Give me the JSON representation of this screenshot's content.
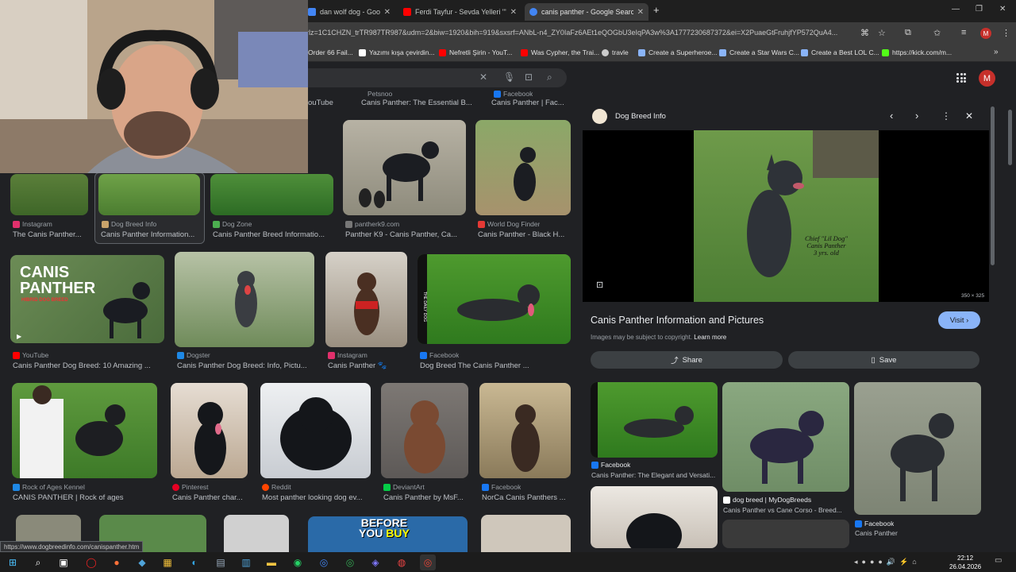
{
  "tabs": [
    {
      "title": "dan wolf dog - Google Se",
      "color": "#4285f4"
    },
    {
      "title": "Ferdi Tayfur - Sevda Yelleri \"\"*\"-",
      "color": "#ff0000"
    },
    {
      "title": "canis panther - Google Search",
      "color": "#4285f4"
    }
  ],
  "url": "rlz=1C1CHZN_trTR987TR987&udm=2&biw=1920&bih=919&sxsrf=ANbL-n4_ZY0IaFz6AEt1eQOGbU3eIqPA3w%3A1777230687372&ei=X2PuaeGtFruhjfYP572QuA4...",
  "bookmarks": [
    {
      "label": "Order 66 Fail...",
      "color": "#9aa0a6"
    },
    {
      "label": "Yazımı kışa çevirdin...",
      "color": "#ffffff"
    },
    {
      "label": "Nefretli Şirin - YouT...",
      "color": "#ff0000"
    },
    {
      "label": "Was Cypher, the Trai...",
      "color": "#ff0000"
    },
    {
      "label": "travle",
      "color": "#cccccc"
    },
    {
      "label": "Create a Superheroe...",
      "color": "#8ab4f8"
    },
    {
      "label": "Create a Star Wars C...",
      "color": "#8ab4f8"
    },
    {
      "label": "Create a Best LOL C...",
      "color": "#8ab4f8"
    },
    {
      "label": "https://kick.com/m...",
      "color": "#53fc18"
    }
  ],
  "top_partial": [
    "ouTube",
    "Canis Panther: The Essential B...",
    "Canis Panther | Fac..."
  ],
  "top_partial_src": [
    "Petsnoo",
    "Facebook"
  ],
  "row1": [
    {
      "src": "Instagram",
      "cap": "The Canis Panther...",
      "color": "#e1306c"
    },
    {
      "src": "Dog Breed Info",
      "cap": "Canis Panther Information...",
      "color": "#c9a36b"
    },
    {
      "src": "Dog Zone",
      "cap": "Canis Panther Breed Informatio...",
      "color": "#4caf50"
    },
    {
      "src": "pantherk9.com",
      "cap": "Panther K9 - Canis Panther, Ca...",
      "color": "#777777"
    },
    {
      "src": "World Dog Finder",
      "cap": "Canis Panther - Black H...",
      "color": "#e53935"
    }
  ],
  "row2": [
    {
      "src": "YouTube",
      "cap": "Canis Panther Dog Breed: 10 Amazing ...",
      "color": "#ff0000"
    },
    {
      "src": "Dogster",
      "cap": "Canis Panther Dog Breed: Info, Pictu...",
      "color": "#1e88e5"
    },
    {
      "src": "Instagram",
      "cap": "Canis Panther 🐾",
      "color": "#e1306c"
    },
    {
      "src": "Facebook",
      "cap": "Dog Breed The Canis Panther ...",
      "color": "#1877f2"
    }
  ],
  "row2_overlay": {
    "line1": "CANIS",
    "line2": "PANTHER",
    "line3": "HIBRID DOG BREED",
    "side": "THE DAILY DOG"
  },
  "row3": [
    {
      "src": "Rock of Ages Kennel",
      "cap": "CANIS PANTHER | Rock of ages",
      "color": "#1e88e5"
    },
    {
      "src": "Pinterest",
      "cap": "Canis Panther char...",
      "color": "#e60023"
    },
    {
      "src": "Reddit",
      "cap": "Most panther looking dog ev...",
      "color": "#ff4500"
    },
    {
      "src": "DeviantArt",
      "cap": "Canis Panther by MsF...",
      "color": "#05cc47"
    },
    {
      "src": "Facebook",
      "cap": "NorCa Canis Panthers ...",
      "color": "#1877f2"
    }
  ],
  "row4_banner": {
    "line1": "BEFORE",
    "line2": "YOU",
    "line3": "BUY"
  },
  "panel": {
    "source": "Dog Breed Info",
    "title": "Canis Panther Information and Pictures",
    "visit": "Visit",
    "copyright": "Images may be subject to copyright.",
    "learn_more": "Learn more",
    "share": "Share",
    "save": "Save",
    "dims": "350 × 325",
    "watermark": [
      "Chief \"Lil Dog\"",
      "Canis Panther",
      "3 yrs. old"
    ]
  },
  "related": [
    {
      "src": "Facebook",
      "cap": "Canis Panther: The Elegant and Versati...",
      "color": "#1877f2"
    },
    {
      "src": "dog breed | MyDogBreeds",
      "cap": "Canis Panther vs Cane Corso - Breed...",
      "color": "#ffffff"
    },
    {
      "src": "Facebook",
      "cap": "Canis Panther",
      "color": "#1877f2"
    }
  ],
  "status_url": "https://www.dogbreedinfo.com/canispanther.htm",
  "clock": {
    "time": "22:12",
    "date": "26.04.2026"
  },
  "profile_letter": "M"
}
